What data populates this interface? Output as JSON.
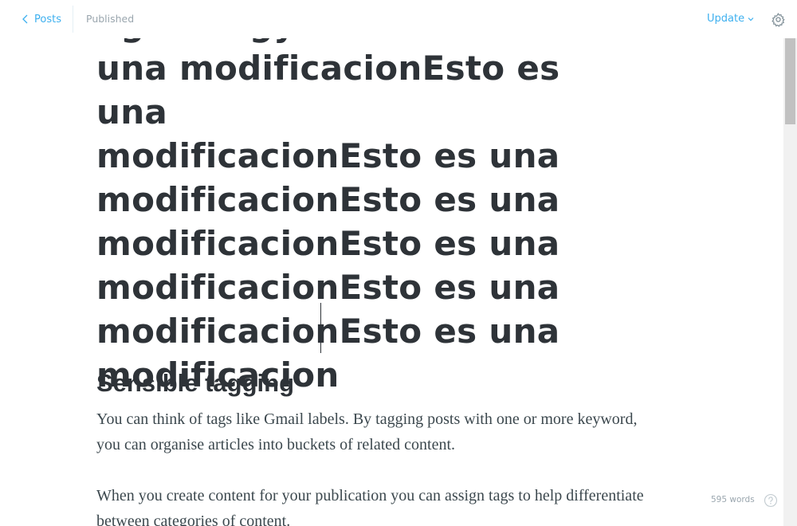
{
  "header": {
    "back_label": "Posts",
    "status": "Published",
    "update_label": "Update"
  },
  "editor": {
    "title_text": "nga ma gy\nuna modificacionEsto es una\nmodificacionEsto es una\nmodificacionEsto es una\nmodificacionEsto es una\nmodificacionEsto es una\nmodificacionEsto es una\nmodificacion",
    "heading": "Sensible tagging",
    "paragraphs": [
      "You can think of tags like Gmail labels. By tagging posts with one or more keyword, you can organise articles into buckets of related content.",
      "When you create content for your publication you can assign tags to help differentiate between categories of content."
    ]
  },
  "footer": {
    "word_count": "595 words"
  },
  "icons": {
    "back": "chevron-left-icon",
    "update_dropdown": "chevron-down-icon",
    "settings": "gear-icon",
    "help": "question-circle-icon"
  },
  "colors": {
    "accent": "#3eb0ef",
    "text": "#2e3338",
    "muted": "#9aa6ae"
  }
}
